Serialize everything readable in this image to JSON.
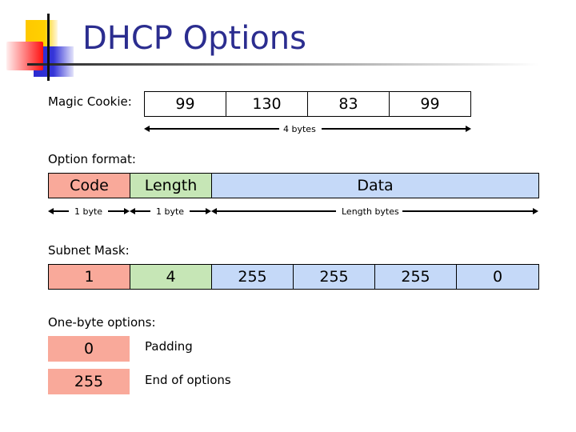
{
  "title": "DHCP Options",
  "colors": {
    "title": "#2b2d8f",
    "code": "#f9a99a",
    "length": "#c6e6b6",
    "data": "#c5d9f8"
  },
  "magic_cookie": {
    "label": "Magic Cookie:",
    "bytes": [
      "99",
      "130",
      "83",
      "99"
    ],
    "span_label": "4 bytes"
  },
  "option_format": {
    "label": "Option format:",
    "fields": [
      {
        "label": "Code",
        "size": "1 byte"
      },
      {
        "label": "Length",
        "size": "1 byte"
      },
      {
        "label": "Data",
        "size": "Length bytes"
      }
    ]
  },
  "subnet_mask": {
    "label": "Subnet Mask:",
    "bytes": [
      "1",
      "4",
      "255",
      "255",
      "255",
      "0"
    ]
  },
  "one_byte_options": {
    "label": "One-byte options:",
    "items": [
      {
        "code": "0",
        "description": "Padding"
      },
      {
        "code": "255",
        "description": "End of options"
      }
    ]
  }
}
